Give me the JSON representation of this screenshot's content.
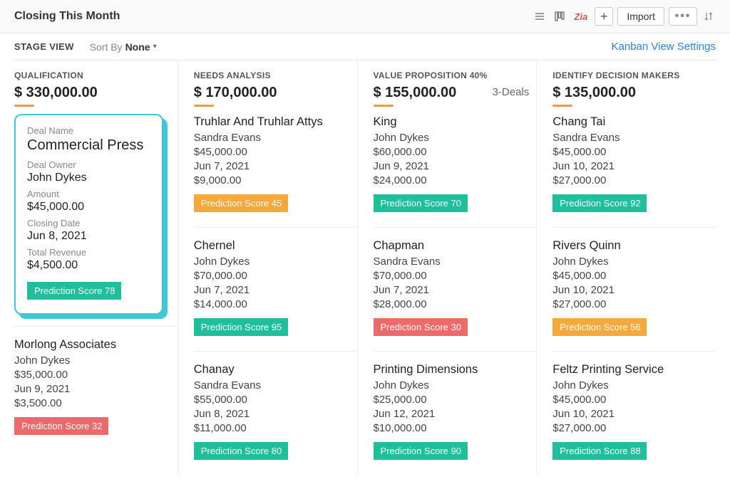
{
  "header": {
    "title": "Closing This Month",
    "zia_label": "Zia",
    "import_label": "Import"
  },
  "subheader": {
    "stage_view": "STAGE VIEW",
    "sort_label": "Sort By",
    "sort_value": "None",
    "kanban_settings": "Kanban View Settings"
  },
  "columns": [
    {
      "stage": "QUALIFICATION",
      "total": "$ 330,000.00",
      "aux": "",
      "cards": [
        {
          "featured": true,
          "labels": {
            "name": "Deal Name",
            "owner": "Deal Owner",
            "amount": "Amount",
            "date": "Closing Date",
            "revenue": "Total Revenue"
          },
          "name": "Commercial Press",
          "owner": "John Dykes",
          "amount": "$45,000.00",
          "date": "Jun 8, 2021",
          "revenue": "$4,500.00",
          "badge": {
            "text": "Prediction Score 78",
            "color": "green"
          }
        },
        {
          "name": "Morlong Associates",
          "owner": "John Dykes",
          "amount": "$35,000.00",
          "date": "Jun 9, 2021",
          "revenue": "$3,500.00",
          "badge": {
            "text": "Prediction Score 32",
            "color": "red"
          }
        }
      ]
    },
    {
      "stage": "NEEDS ANALYSIS",
      "total": "$ 170,000.00",
      "aux": "",
      "cards": [
        {
          "name": "Truhlar And Truhlar Attys",
          "owner": "Sandra Evans",
          "amount": "$45,000.00",
          "date": "Jun 7, 2021",
          "revenue": "$9,000.00",
          "badge": {
            "text": "Prediction Score 45",
            "color": "orange"
          }
        },
        {
          "name": "Chernel",
          "owner": "John Dykes",
          "amount": "$70,000.00",
          "date": "Jun 7, 2021",
          "revenue": "$14,000.00",
          "badge": {
            "text": "Prediction Score 95",
            "color": "green"
          }
        },
        {
          "name": "Chanay",
          "owner": "Sandra Evans",
          "amount": "$55,000.00",
          "date": "Jun 8, 2021",
          "revenue": "$11,000.00",
          "badge": {
            "text": "Prediction Score 80",
            "color": "green"
          }
        }
      ]
    },
    {
      "stage": "VALUE PROPOSITION 40%",
      "total": "$ 155,000.00",
      "aux": "3-Deals",
      "cards": [
        {
          "name": "King",
          "owner": "John Dykes",
          "amount": "$60,000.00",
          "date": "Jun 9, 2021",
          "revenue": "$24,000.00",
          "badge": {
            "text": "Prediction Score 70",
            "color": "green"
          }
        },
        {
          "name": "Chapman",
          "owner": "Sandra Evans",
          "amount": "$70,000.00",
          "date": "Jun 7, 2021",
          "revenue": "$28,000.00",
          "badge": {
            "text": "Prediction Score 30",
            "color": "red"
          }
        },
        {
          "name": "Printing Dimensions",
          "owner": "John Dykes",
          "amount": "$25,000.00",
          "date": "Jun 12, 2021",
          "revenue": "$10,000.00",
          "badge": {
            "text": "Prediction Score 90",
            "color": "green"
          }
        }
      ]
    },
    {
      "stage": "IDENTIFY DECISION MAKERS",
      "total": "$ 135,000.00",
      "aux": "",
      "cards": [
        {
          "name": "Chang Tai",
          "owner": "Sandra Evans",
          "amount": "$45,000.00",
          "date": "Jun 10, 2021",
          "revenue": "$27,000.00",
          "badge": {
            "text": "Prediction Score 92",
            "color": "green"
          }
        },
        {
          "name": "Rivers Quinn",
          "owner": "John Dykes",
          "amount": "$45,000.00",
          "date": "Jun 10, 2021",
          "revenue": "$27,000.00",
          "badge": {
            "text": "Prediction Score 56",
            "color": "orange"
          }
        },
        {
          "name": "Feltz Printing Service",
          "owner": "John Dykes",
          "amount": "$45,000.00",
          "date": "Jun 10, 2021",
          "revenue": "$27,000.00",
          "badge": {
            "text": "Prediction Score 88",
            "color": "green"
          }
        }
      ]
    }
  ]
}
